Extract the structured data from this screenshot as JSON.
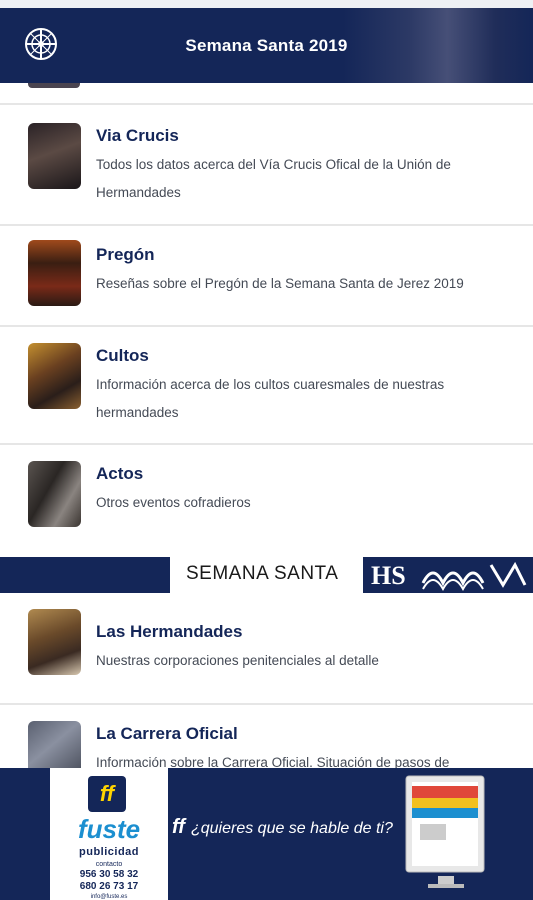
{
  "appbar": {
    "title": "Semana Santa 2019"
  },
  "items": [
    {
      "title": "Via Crucis",
      "desc": "Todos los datos acerca del Vía Crucis Ofical de la Unión de Hermandades"
    },
    {
      "title": "Pregón",
      "desc": "Reseñas sobre el Pregón de la Semana Santa de Jerez 2019"
    },
    {
      "title": "Cultos",
      "desc": "Información acerca de los cultos cuaresmales de nuestras hermandades"
    },
    {
      "title": "Actos",
      "desc": "Otros eventos cofradieros"
    }
  ],
  "section": {
    "label": "SEMANA SANTA",
    "crest_text": "HS"
  },
  "items2": [
    {
      "title": "Las Hermandades",
      "desc": "Nuestras corporaciones penitenciales al detalle"
    },
    {
      "title": "La Carrera Oficial",
      "desc": "Información sobre la Carrera Oficial. Situación de pasos de"
    }
  ],
  "ad": {
    "brand": "fuste",
    "brand_sub": "publicidad",
    "contact_label": "contacto",
    "phone1": "956 30 58 32",
    "phone2": "680 26 73 17",
    "email": "info@fuste.es",
    "tagline": "¿quieres que se hable de ti?",
    "ff_mark": "ff"
  },
  "colors": {
    "primary": "#142658",
    "accent": "#ffd400",
    "brand_blue": "#1c8fd0"
  },
  "icons": [
    "emblem-icon",
    "ff-logo-icon",
    "monitor-icon"
  ]
}
